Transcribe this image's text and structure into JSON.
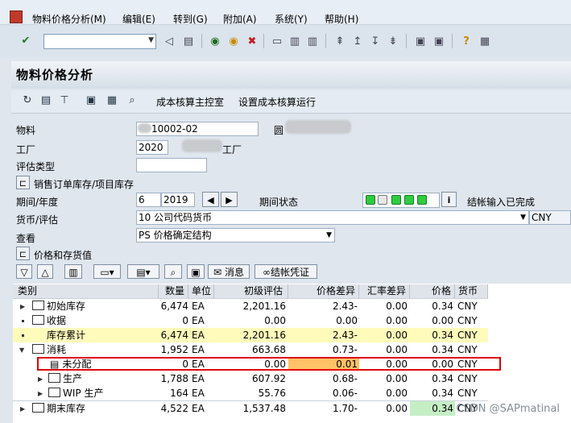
{
  "menu": [
    "物料价格分析(M)",
    "编辑(E)",
    "转到(G)",
    "附加(A)",
    "系统(Y)",
    "帮助(H)"
  ],
  "title": "物料价格分析",
  "app_toolbar": {
    "costing_cockpit": "成本核算主控室",
    "setup_costing_run": "设置成本核算运行"
  },
  "form": {
    "material_label": "物料",
    "material_value": "10002-02",
    "material_desc_prefix": "圆",
    "plant_label": "工厂",
    "plant_value": "2020",
    "plant_desc_suffix": "工厂",
    "valuation_type_label": "评估类型",
    "valuation_type_value": "",
    "sales_order_stock_label": "销售订单库存/项目库存",
    "period_year_label": "期间/年度",
    "period_value": "6",
    "year_value": "2019",
    "period_status_label": "期间状态",
    "period_status_text": "结帐输入已完成",
    "currency_valuation_label": "货币/评估",
    "currency_valuation_value": "10 公司代码货币",
    "currency_value": "CNY",
    "view_label": "查看",
    "view_value": "PS 价格确定结构",
    "prices_stock_label": "价格和存货值"
  },
  "grid_toolbar": {
    "messages": "消息",
    "settlement_doc": "结帐凭证"
  },
  "table": {
    "headers": [
      "类别",
      "数量",
      "单位",
      "初级评估",
      "价格差异",
      "汇率差异",
      "价格",
      "货币"
    ],
    "rows": [
      {
        "category": "初始库存",
        "qty": "6,474",
        "unit": "EA",
        "prelim": "2,201.16",
        "price_diff": "2.43-",
        "exch_diff": "0.00",
        "price": "0.34",
        "cur": "CNY"
      },
      {
        "category": "收据",
        "qty": "0",
        "unit": "EA",
        "prelim": "0.00",
        "price_diff": "0.00",
        "exch_diff": "0.00",
        "price": "0.00",
        "cur": "CNY"
      },
      {
        "category": "库存累计",
        "qty": "6,474",
        "unit": "EA",
        "prelim": "2,201.16",
        "price_diff": "2.43-",
        "exch_diff": "0.00",
        "price": "0.34",
        "cur": "CNY"
      },
      {
        "category": "消耗",
        "qty": "1,952",
        "unit": "EA",
        "prelim": "663.68",
        "price_diff": "0.73-",
        "exch_diff": "0.00",
        "price": "0.34",
        "cur": "CNY"
      },
      {
        "category": "未分配",
        "qty": "0",
        "unit": "EA",
        "prelim": "0.00",
        "price_diff": "0.01",
        "exch_diff": "0.00",
        "price": "0.00",
        "cur": "CNY"
      },
      {
        "category": "生产",
        "qty": "1,788",
        "unit": "EA",
        "prelim": "607.92",
        "price_diff": "0.68-",
        "exch_diff": "0.00",
        "price": "0.34",
        "cur": "CNY"
      },
      {
        "category": "WIP 生产",
        "qty": "164",
        "unit": "EA",
        "prelim": "55.76",
        "price_diff": "0.06-",
        "exch_diff": "0.00",
        "price": "0.34",
        "cur": "CNY"
      },
      {
        "category": "期末库存",
        "qty": "4,522",
        "unit": "EA",
        "prelim": "1,537.48",
        "price_diff": "1.70-",
        "exch_diff": "0.00",
        "price": "0.34",
        "cur": "CNY"
      }
    ]
  },
  "watermark": "CSDN @SAPmatinal",
  "colors": {
    "highlight_row": "#fffbbb",
    "orange_cell": "#ffc266",
    "green_cell": "#c5eec5",
    "red_box": "#e00000"
  }
}
